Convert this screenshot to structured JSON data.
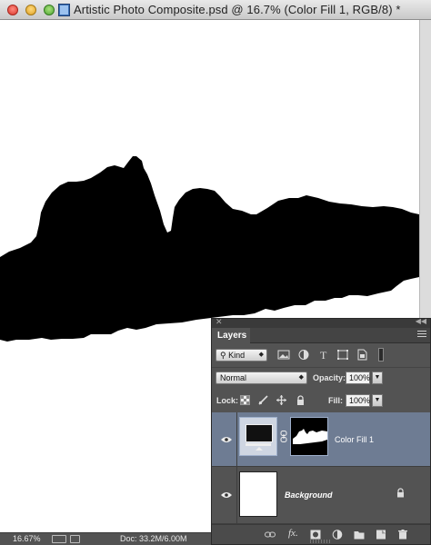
{
  "window": {
    "title": "Artistic Photo Composite.psd @ 16.7% (Color Fill 1, RGB/8) *"
  },
  "status": {
    "zoom": "16.67%",
    "doc_size": "Doc: 33.2M/6.00M"
  },
  "layers_panel": {
    "tab_label": "Layers",
    "filter": {
      "kind_label": "Kind",
      "icons": [
        "image-filter-icon",
        "adjustment-filter-icon",
        "type-filter-icon",
        "shape-filter-icon",
        "smart-object-filter-icon"
      ]
    },
    "blend_mode": "Normal",
    "opacity_label": "Opacity:",
    "opacity_value": "100%",
    "lock_label": "Lock:",
    "fill_label": "Fill:",
    "fill_value": "100%",
    "layers": [
      {
        "name": "Color Fill 1",
        "selected": true,
        "visible": true
      },
      {
        "name": "Background",
        "selected": false,
        "visible": true,
        "locked": true
      }
    ],
    "bottom_icons": [
      "link-layers-icon",
      "fx-icon",
      "add-mask-icon",
      "adjustment-layer-icon",
      "new-group-icon",
      "new-layer-icon",
      "delete-layer-icon"
    ],
    "fx_label": "fx."
  },
  "colors": {
    "panel_bg": "#535353",
    "selected_layer": "#6e7c93",
    "canvas_bg": "#ffffff",
    "silhouette": "#000000"
  }
}
